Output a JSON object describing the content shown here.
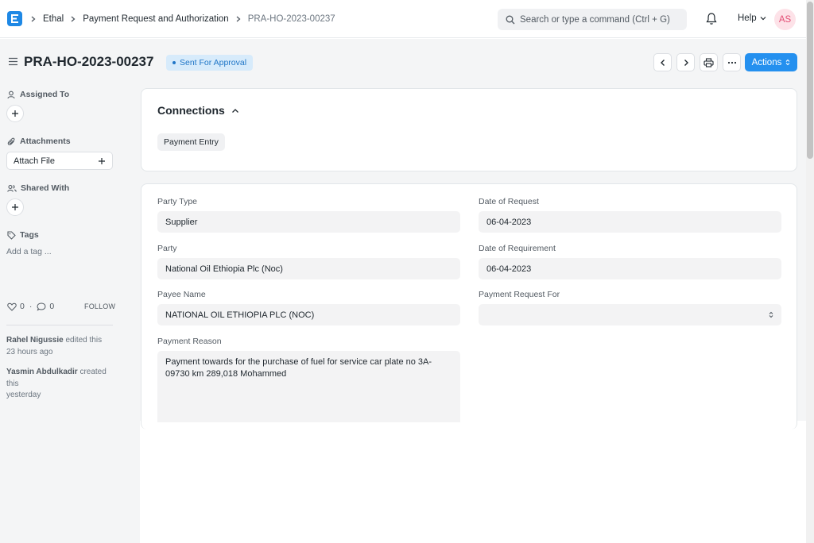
{
  "app": {
    "logo_letter": "E",
    "brand_color": "#1e88e5"
  },
  "breadcrumbs": [
    "Ethal",
    "Payment Request and Authorization",
    "PRA-HO-2023-00237"
  ],
  "search": {
    "placeholder": "Search or type a command (Ctrl + G)"
  },
  "navbar": {
    "help_label": "Help",
    "avatar_initials": "AS",
    "icons": [
      "search-icon",
      "bell-icon",
      "chevron-down-icon"
    ]
  },
  "header": {
    "title": "PRA-HO-2023-00237",
    "status": "Sent For Approval",
    "actions_label": "Actions",
    "icons": [
      "menu-icon",
      "chevron-left-icon",
      "chevron-right-icon",
      "printer-icon",
      "ellipsis-icon",
      "sort-icon"
    ]
  },
  "sidebar": {
    "assigned_to_label": "Assigned To",
    "attachments_label": "Attachments",
    "attach_file_label": "Attach File",
    "shared_with_label": "Shared With",
    "tags_label": "Tags",
    "add_tag_label": "Add a tag ...",
    "likes_count": "0",
    "comments_count": "0",
    "separator": "·",
    "follow_label": "FOLLOW",
    "timeline": [
      {
        "user": "Rahel Nigussie",
        "action": "edited this",
        "time": "23 hours ago"
      },
      {
        "user": "Yasmin Abdulkadir",
        "action": "created this",
        "time": "yesterday"
      }
    ]
  },
  "connections": {
    "title": "Connections",
    "chips": [
      "Payment Entry"
    ]
  },
  "form": {
    "party_type": {
      "label": "Party Type",
      "value": "Supplier"
    },
    "party": {
      "label": "Party",
      "value": "National Oil Ethiopia Plc (Noc)"
    },
    "payee_name": {
      "label": "Payee Name",
      "value": "NATIONAL OIL ETHIOPIA PLC (NOC)"
    },
    "payment_reason": {
      "label": "Payment Reason",
      "value": "Payment towards for the purchase of fuel for service car plate no 3A-09730 km 289,018 Mohammed"
    },
    "date_of_request": {
      "label": "Date of Request",
      "value": "06-04-2023"
    },
    "date_of_requirement": {
      "label": "Date of Requirement",
      "value": "06-04-2023"
    },
    "payment_request_for": {
      "label": "Payment Request For",
      "value": ""
    }
  }
}
